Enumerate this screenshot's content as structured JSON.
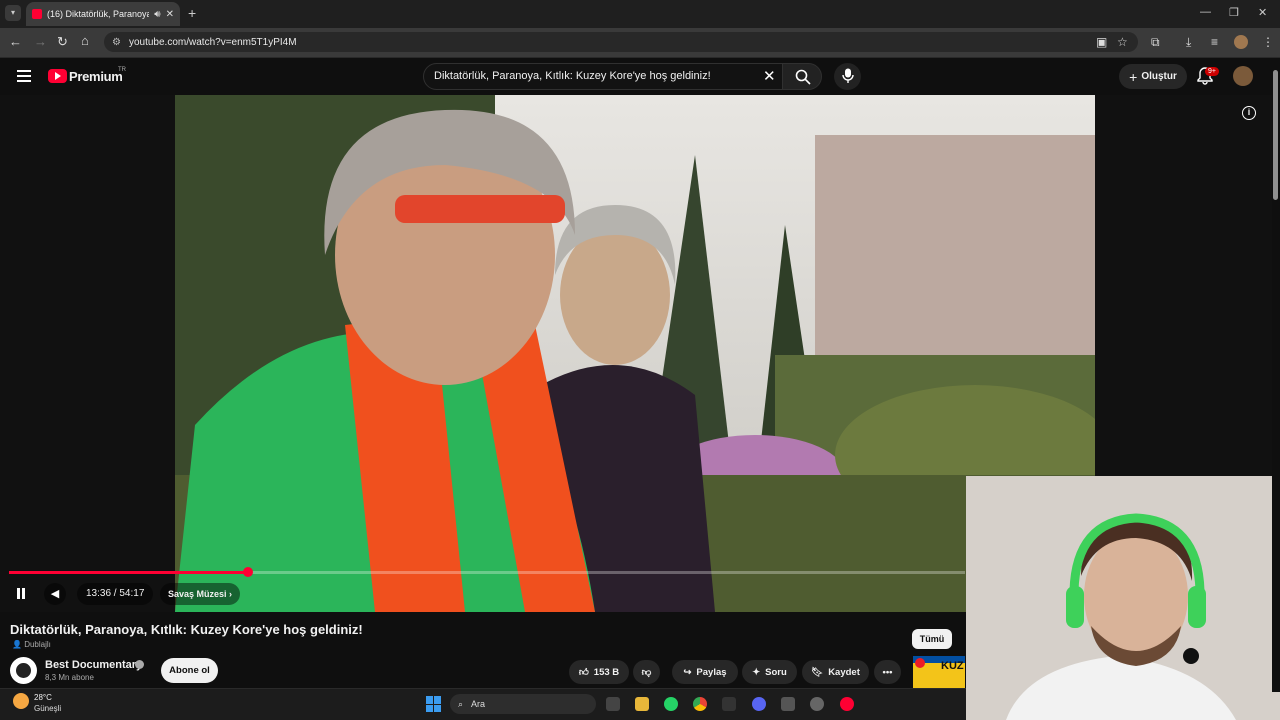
{
  "browser": {
    "tab_title": "(16) Diktatörlük, Paranoya, Kıtlık: Kuzey Kore'ye hoş geldiniz!",
    "url": "youtube.com/watch?v=enm5T1yPI4M"
  },
  "header": {
    "brand": "Premium",
    "country": "TR",
    "search_value": "Diktatörlük, Paranoya, Kıtlık: Kuzey Kore'ye hoş geldiniz!",
    "create_label": "Oluştur",
    "notification_count": "9+"
  },
  "player": {
    "time": "13:36 / 54:17",
    "progress_fraction": 0.25,
    "chapter": "Savaş Müzesi"
  },
  "video": {
    "title": "Diktatörlük, Paranoya, Kıtlık: Kuzey Kore'ye hoş geldiniz!",
    "dubbed": "Dublajlı",
    "channel": "Best Documentary",
    "subscribers": "8,3 Mn abone",
    "subscribe_label": "Abone ol",
    "likes": "153 B",
    "share_label": "Paylaş",
    "ask_label": "Soru",
    "save_label": "Kaydet"
  },
  "sidebar": {
    "filter_all": "Tümü",
    "thumb_text": "KUZ"
  },
  "taskbar": {
    "temperature": "28°C",
    "condition": "Güneşli",
    "search_placeholder": "Ara"
  },
  "colors": {
    "accent": "#ff0033",
    "background": "#0f0f0f"
  }
}
